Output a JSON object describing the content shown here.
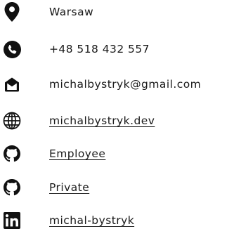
{
  "contacts": {
    "location": {
      "text": "Warsaw",
      "icon": "map-pin-icon"
    },
    "phone": {
      "text": "+48 518 432 557",
      "icon": "phone-icon"
    },
    "email": {
      "text": "michalbystryk@gmail.com",
      "icon": "envelope-icon"
    },
    "website": {
      "text": "michalbystryk.dev",
      "icon": "globe-icon"
    },
    "github_employee": {
      "text": "Employee",
      "icon": "github-icon"
    },
    "github_private": {
      "text": "Private",
      "icon": "github-icon"
    },
    "linkedin": {
      "text": "michal-bystryk",
      "icon": "linkedin-icon"
    }
  },
  "colors": {
    "icon": "#111111",
    "text": "#1a1a1a",
    "background": "#ffffff"
  }
}
